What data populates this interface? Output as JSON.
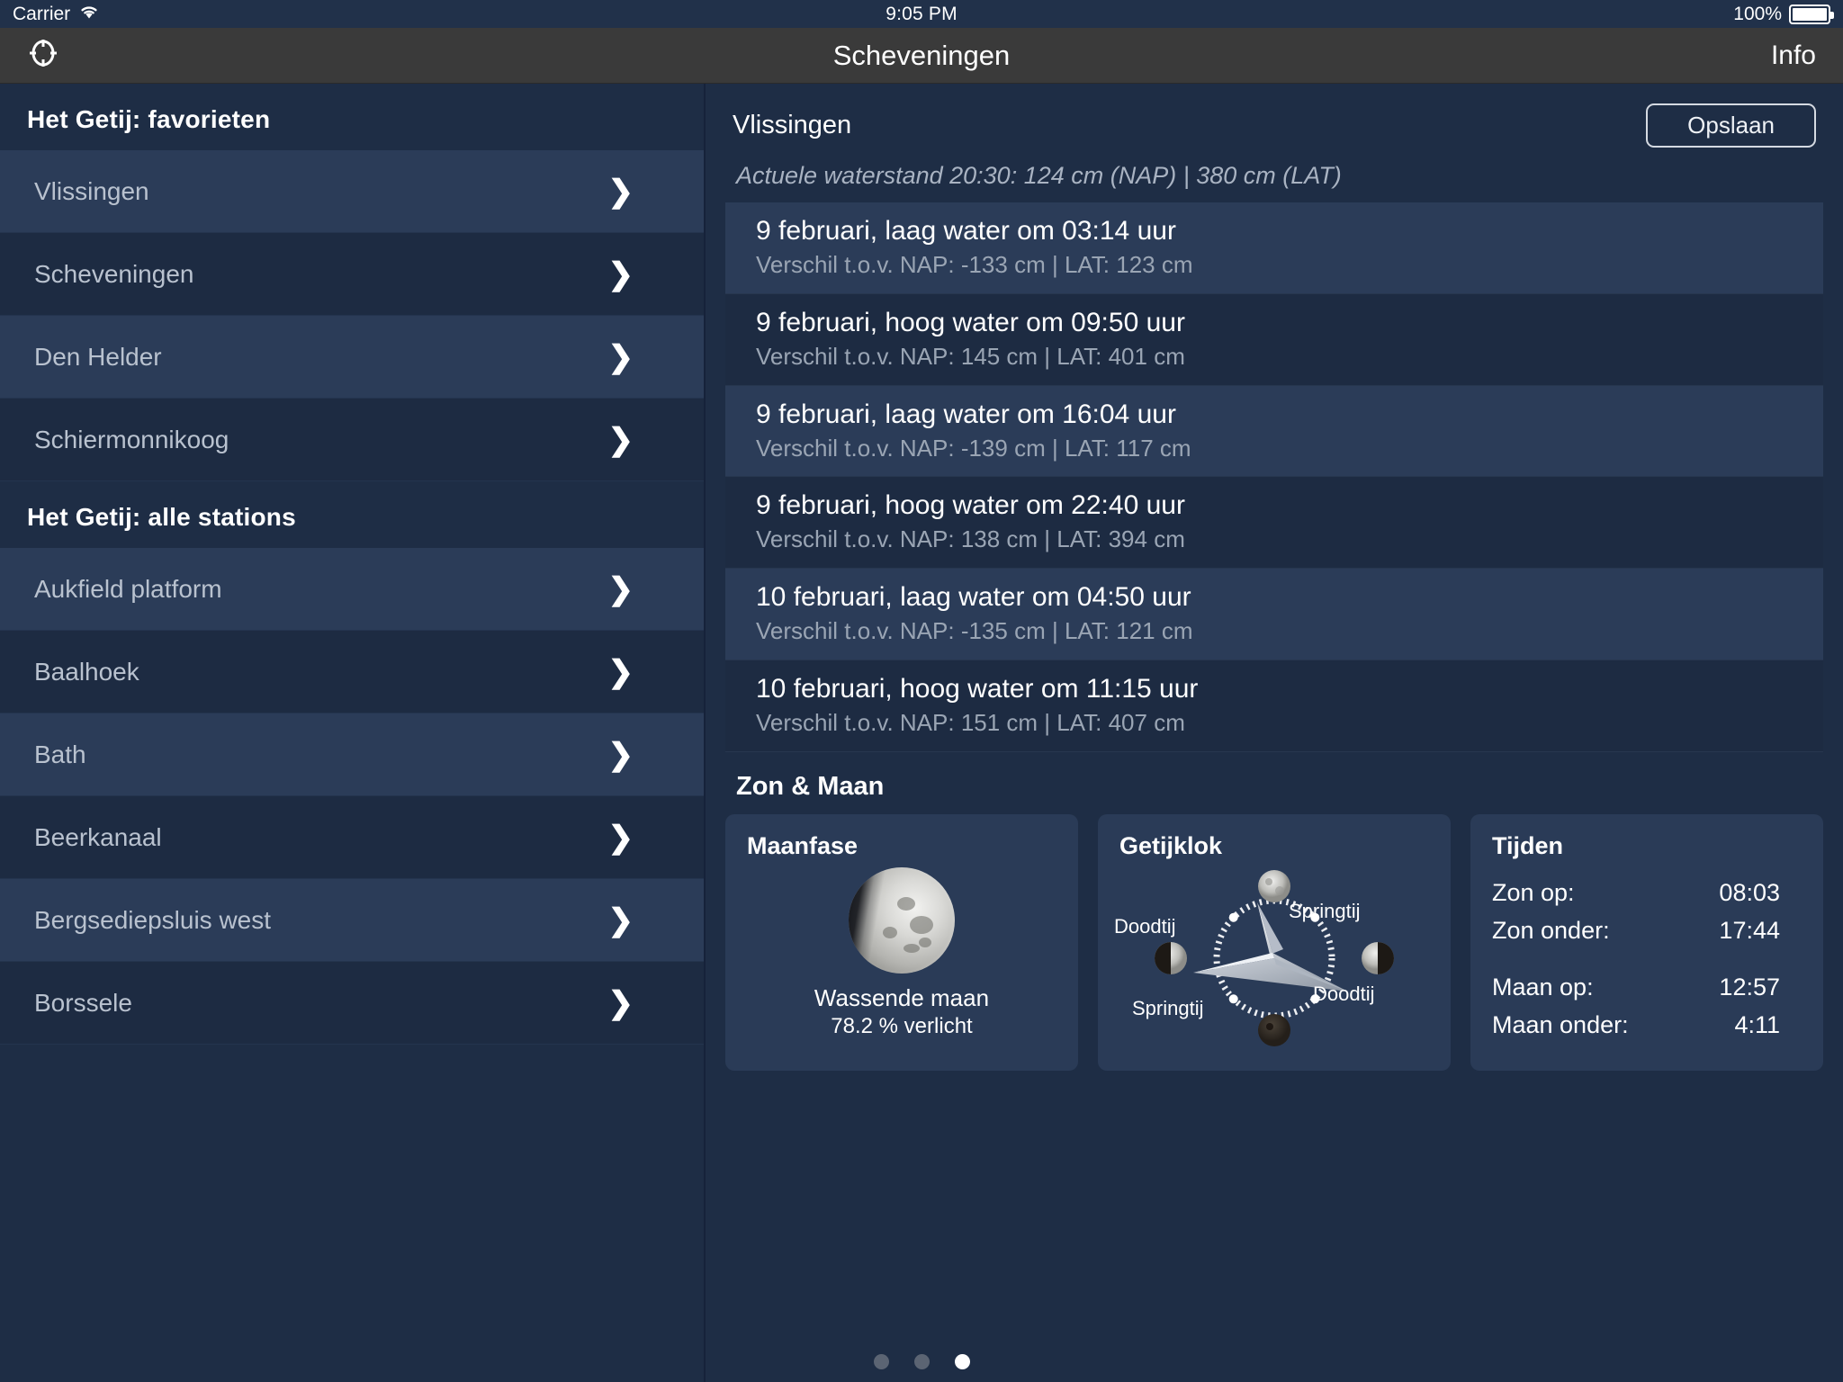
{
  "statusbar": {
    "carrier": "Carrier",
    "wifi_icon": "wifi-icon",
    "time": "9:05 PM",
    "battery_pct": "100%",
    "battery_icon": "battery-full-icon"
  },
  "navbar": {
    "left_icon": "target-crosshair-icon",
    "title": "Scheveningen",
    "info_label": "Info"
  },
  "left": {
    "favorites_header": "Het Getij: favorieten",
    "favorites": [
      {
        "name": "Vlissingen"
      },
      {
        "name": "Scheveningen"
      },
      {
        "name": "Den Helder"
      },
      {
        "name": "Schiermonnikoog"
      }
    ],
    "all_stations_header": "Het Getij: alle stations",
    "all_stations": [
      {
        "name": "Aukfield platform"
      },
      {
        "name": "Baalhoek"
      },
      {
        "name": "Bath"
      },
      {
        "name": "Beerkanaal"
      },
      {
        "name": "Bergsediepsluis west"
      },
      {
        "name": "Borssele"
      }
    ],
    "chevron_icon": "chevron-right-icon"
  },
  "right": {
    "station_title": "Vlissingen",
    "save_label": "Opslaan",
    "current_level": "Actuele waterstand 20:30: 124 cm (NAP) | 380 cm (LAT)",
    "tides": [
      {
        "main": "9 februari, laag water om 03:14 uur",
        "sub": "Verschil t.o.v. NAP: -133 cm | LAT: 123 cm"
      },
      {
        "main": "9 februari, hoog water om 09:50 uur",
        "sub": "Verschil t.o.v. NAP: 145 cm | LAT: 401 cm"
      },
      {
        "main": "9 februari, laag water om 16:04 uur",
        "sub": "Verschil t.o.v. NAP: -139 cm | LAT: 117 cm"
      },
      {
        "main": "9 februari, hoog water om 22:40 uur",
        "sub": "Verschil t.o.v. NAP: 138 cm | LAT: 394 cm"
      },
      {
        "main": "10 februari, laag water om 04:50 uur",
        "sub": "Verschil t.o.v. NAP: -135 cm | LAT: 121 cm"
      },
      {
        "main": "10 februari, hoog water om 11:15 uur",
        "sub": "Verschil t.o.v. NAP: 151 cm | LAT: 407 cm"
      }
    ],
    "zon_maan_title": "Zon & Maan",
    "moon_card": {
      "title": "Maanfase",
      "phase": "Wassende maan",
      "illumination": "78.2 % verlicht",
      "icon": "moon-waxing-gibbous-icon"
    },
    "tide_clock_card": {
      "title": "Getijklok",
      "labels": {
        "top_right": "Springtij",
        "left": "Doodtij",
        "right": "Doodtij",
        "bottom_left": "Springtij"
      },
      "moon_icons": [
        "full-moon-icon",
        "last-quarter-moon-icon",
        "new-moon-icon",
        "first-quarter-moon-icon"
      ],
      "needle_icon": "compass-needle-icon"
    },
    "times_card": {
      "title": "Tijden",
      "rows": [
        {
          "label": "Zon op:",
          "value": "08:03"
        },
        {
          "label": "Zon onder:",
          "value": "17:44"
        },
        {
          "label": "Maan op:",
          "value": "12:57"
        },
        {
          "label": "Maan onder:",
          "value": "4:11"
        }
      ]
    }
  },
  "pagination": {
    "total": 3,
    "active": 3
  },
  "colors": {
    "background": "#1e2d45",
    "row_light": "#2b3c58",
    "row_dark": "#1d2b42",
    "navbar": "#3a3a3a",
    "statusbar": "#21314a",
    "card": "#2a3b57",
    "accent_text": "#ffffff",
    "muted_text": "#9aa5b4"
  }
}
